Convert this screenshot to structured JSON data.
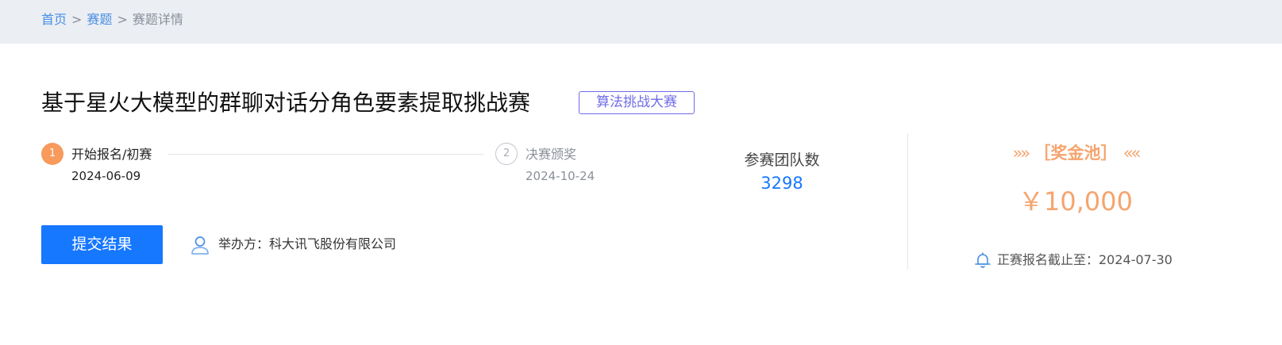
{
  "breadcrumb": {
    "home": "首页",
    "separator": ">",
    "section": "赛题",
    "current": "赛题详情"
  },
  "competition": {
    "title": "基于星火大模型的群聊对话分角色要素提取挑战赛",
    "tag": "算法挑战大赛"
  },
  "steps": [
    {
      "index": "1",
      "label": "开始报名/初赛",
      "date": "2024-06-09",
      "status": "active"
    },
    {
      "index": "2",
      "label": "决赛颁奖",
      "date": "2024-10-24",
      "status": "pending"
    }
  ],
  "teams": {
    "label": "参赛团队数",
    "count": "3298"
  },
  "prize_pool": {
    "left_decoration": "»»",
    "title": "［奖金池］",
    "right_decoration": "««",
    "amount": "￥10,000"
  },
  "deadline": {
    "icon": "bell-icon",
    "text": "正赛报名截止至：2024-07-30"
  },
  "actions": {
    "submit_label": "提交结果"
  },
  "organizer": {
    "icon": "user-icon",
    "text": "举办方：科大讯飞股份有限公司"
  },
  "colors": {
    "primary": "#1677ff",
    "link": "#4a8fe3",
    "accent_orange": "#f6a46e",
    "step_active": "#f79a5c",
    "tag_purple": "#6f6ce8",
    "breadcrumb_bg": "#ebeef3"
  }
}
